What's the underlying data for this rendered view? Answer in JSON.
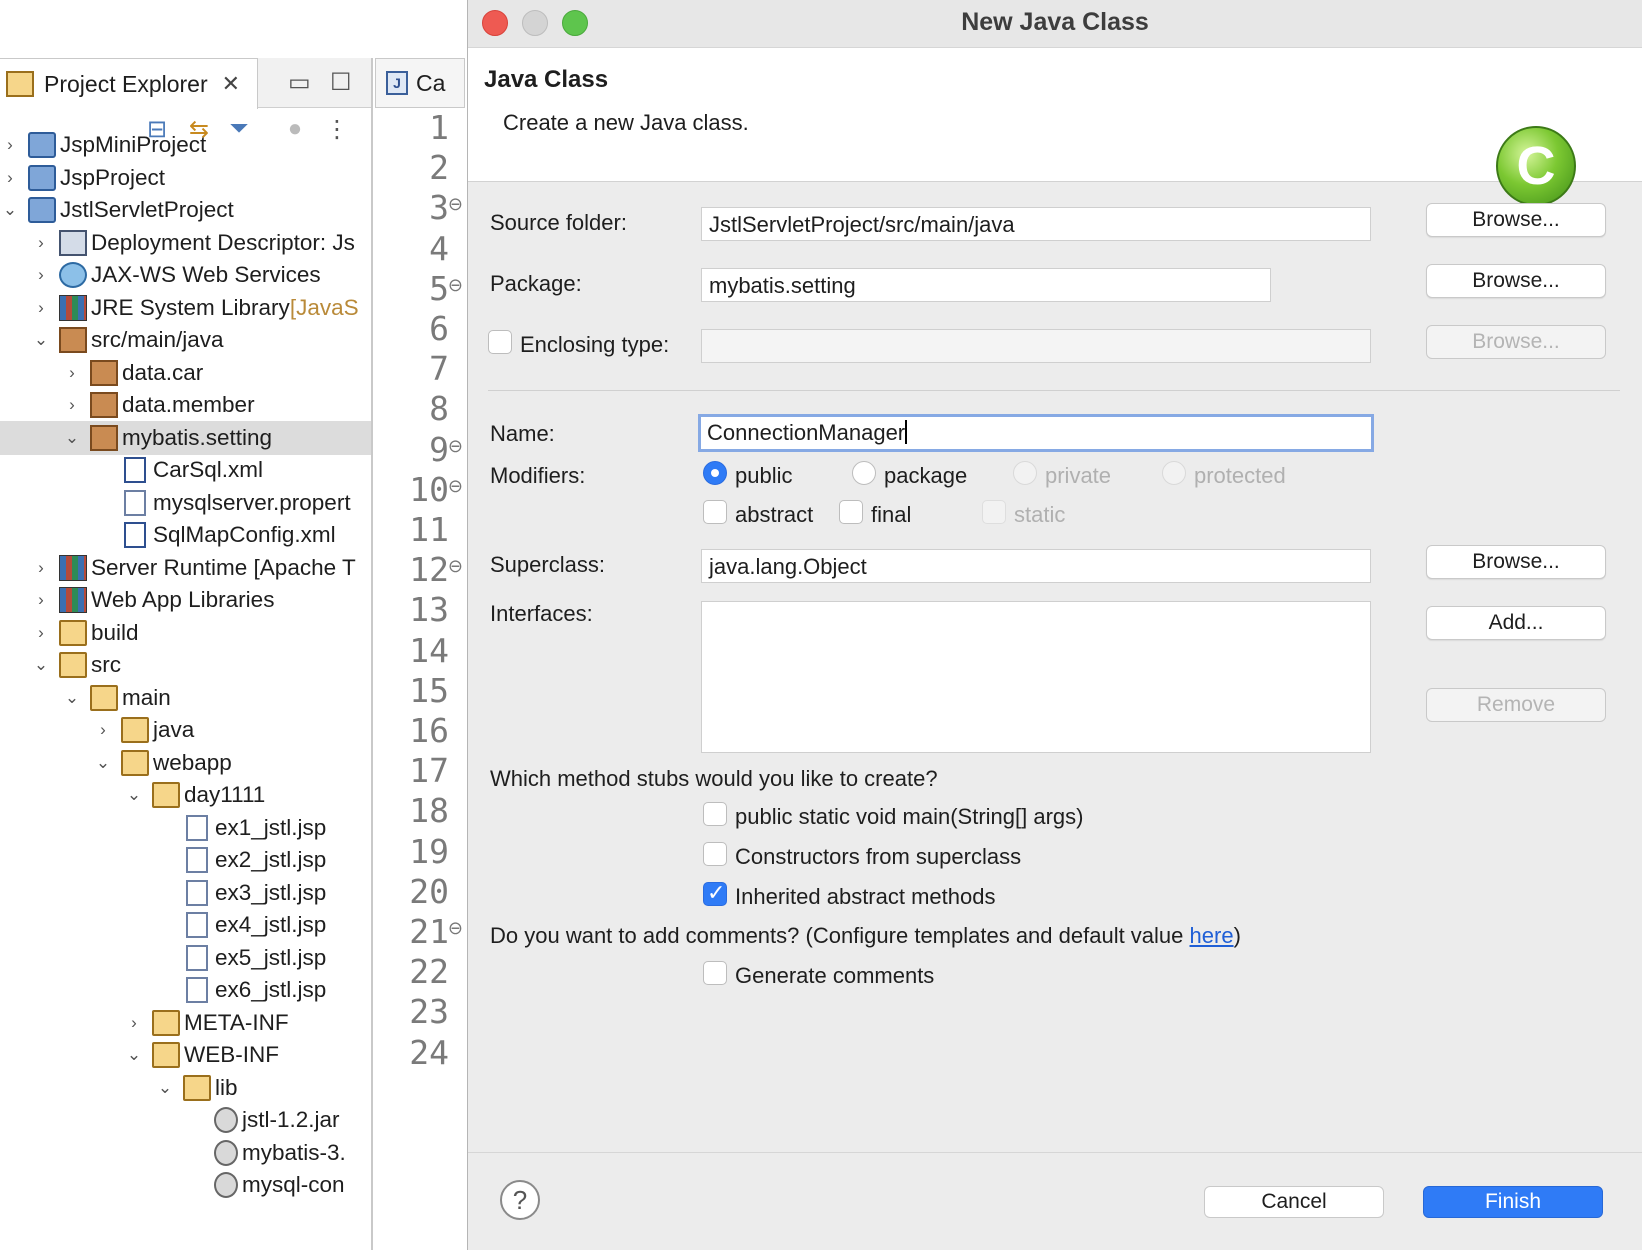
{
  "project_explorer": {
    "tab_title": "Project Explorer",
    "tree": [
      {
        "label": "JspMiniProject",
        "twisty": "›",
        "indent": 0,
        "icon": "project-icon"
      },
      {
        "label": "JspProject",
        "twisty": "›",
        "indent": 0,
        "icon": "project-icon"
      },
      {
        "label": "JstlServletProject",
        "twisty": "⌄",
        "indent": 0,
        "icon": "project-icon"
      },
      {
        "label": "Deployment Descriptor: Js",
        "twisty": "›",
        "indent": 1,
        "icon": "deployment-descriptor-icon"
      },
      {
        "label": "JAX-WS Web Services",
        "twisty": "›",
        "indent": 1,
        "icon": "web-services-icon"
      },
      {
        "label": "JRE System Library",
        "suffix": " [JavaS",
        "twisty": "›",
        "indent": 1,
        "icon": "library-icon"
      },
      {
        "label": "src/main/java",
        "twisty": "⌄",
        "indent": 1,
        "icon": "source-folder-icon"
      },
      {
        "label": "data.car",
        "twisty": "›",
        "indent": 2,
        "icon": "package-icon"
      },
      {
        "label": "data.member",
        "twisty": "›",
        "indent": 2,
        "icon": "package-icon"
      },
      {
        "label": "mybatis.setting",
        "twisty": "⌄",
        "indent": 2,
        "icon": "package-icon",
        "selected": true
      },
      {
        "label": "CarSql.xml",
        "twisty": "",
        "indent": 3,
        "icon": "xml-file-icon"
      },
      {
        "label": "mysqlserver.propert",
        "twisty": "",
        "indent": 3,
        "icon": "properties-file-icon"
      },
      {
        "label": "SqlMapConfig.xml",
        "twisty": "",
        "indent": 3,
        "icon": "xml-file-icon"
      },
      {
        "label": "Server Runtime [Apache T",
        "twisty": "›",
        "indent": 1,
        "icon": "library-icon"
      },
      {
        "label": "Web App Libraries",
        "twisty": "›",
        "indent": 1,
        "icon": "library-icon"
      },
      {
        "label": "build",
        "twisty": "›",
        "indent": 1,
        "icon": "folder-icon"
      },
      {
        "label": "src",
        "twisty": "⌄",
        "indent": 1,
        "icon": "folder-icon"
      },
      {
        "label": "main",
        "twisty": "⌄",
        "indent": 2,
        "icon": "folder-icon"
      },
      {
        "label": "java",
        "twisty": "›",
        "indent": 3,
        "icon": "folder-icon"
      },
      {
        "label": "webapp",
        "twisty": "⌄",
        "indent": 3,
        "icon": "folder-icon"
      },
      {
        "label": "day1111",
        "twisty": "⌄",
        "indent": 4,
        "icon": "folder-icon"
      },
      {
        "label": "ex1_jstl.jsp",
        "twisty": "",
        "indent": 5,
        "icon": "jsp-file-icon"
      },
      {
        "label": "ex2_jstl.jsp",
        "twisty": "",
        "indent": 5,
        "icon": "jsp-file-icon"
      },
      {
        "label": "ex3_jstl.jsp",
        "twisty": "",
        "indent": 5,
        "icon": "jsp-file-icon"
      },
      {
        "label": "ex4_jstl.jsp",
        "twisty": "",
        "indent": 5,
        "icon": "jsp-file-icon"
      },
      {
        "label": "ex5_jstl.jsp",
        "twisty": "",
        "indent": 5,
        "icon": "jsp-file-icon"
      },
      {
        "label": "ex6_jstl.jsp",
        "twisty": "",
        "indent": 5,
        "icon": "jsp-file-icon"
      },
      {
        "label": "META-INF",
        "twisty": "›",
        "indent": 4,
        "icon": "folder-icon"
      },
      {
        "label": "WEB-INF",
        "twisty": "⌄",
        "indent": 4,
        "icon": "folder-icon"
      },
      {
        "label": "lib",
        "twisty": "⌄",
        "indent": 5,
        "icon": "folder-icon"
      },
      {
        "label": "jstl-1.2.jar",
        "twisty": "",
        "indent": 6,
        "icon": "jar-icon"
      },
      {
        "label": "mybatis-3.",
        "twisty": "",
        "indent": 6,
        "icon": "jar-icon"
      },
      {
        "label": "mysql-con",
        "twisty": "",
        "indent": 6,
        "icon": "jar-icon"
      }
    ]
  },
  "editor": {
    "tab_label": "Ca",
    "line_numbers": [
      "1",
      "2",
      "3",
      "4",
      "5",
      "6",
      "7",
      "8",
      "9",
      "10",
      "11",
      "12",
      "13",
      "14",
      "15",
      "16",
      "17",
      "18",
      "19",
      "20",
      "21",
      "22",
      "23",
      "24"
    ],
    "fold_lines": [
      "3",
      "5",
      "9",
      "10",
      "12",
      "21"
    ]
  },
  "dialog": {
    "window_title": "New Java Class",
    "banner_title": "Java Class",
    "banner_description": "Create a new Java class.",
    "source_folder": {
      "label": "Source folder:",
      "value": "JstlServletProject/src/main/java",
      "button": "Browse..."
    },
    "package": {
      "label": "Package:",
      "value": "mybatis.setting",
      "button": "Browse..."
    },
    "enclosing_type": {
      "label": "Enclosing type:",
      "value": "",
      "button": "Browse..."
    },
    "name": {
      "label": "Name:",
      "value": "ConnectionManager"
    },
    "modifiers": {
      "label": "Modifiers:",
      "access": [
        "public",
        "package",
        "private",
        "protected"
      ],
      "selected_access": "public",
      "flags": [
        "abstract",
        "final",
        "static"
      ]
    },
    "superclass": {
      "label": "Superclass:",
      "value": "java.lang.Object",
      "button": "Browse..."
    },
    "interfaces": {
      "label": "Interfaces:",
      "add_button": "Add...",
      "remove_button": "Remove"
    },
    "method_stubs": {
      "question": "Which method stubs would you like to create?",
      "options": [
        {
          "label": "public static void main(String[] args)",
          "checked": false
        },
        {
          "label": "Constructors from superclass",
          "checked": false
        },
        {
          "label": "Inherited abstract methods",
          "checked": true
        }
      ]
    },
    "comments": {
      "question_prefix": "Do you want to add comments? (Configure templates and default value ",
      "question_link": "here",
      "question_suffix": ")",
      "generate_label": "Generate comments"
    },
    "help_label": "?",
    "cancel_label": "Cancel",
    "finish_label": "Finish"
  }
}
